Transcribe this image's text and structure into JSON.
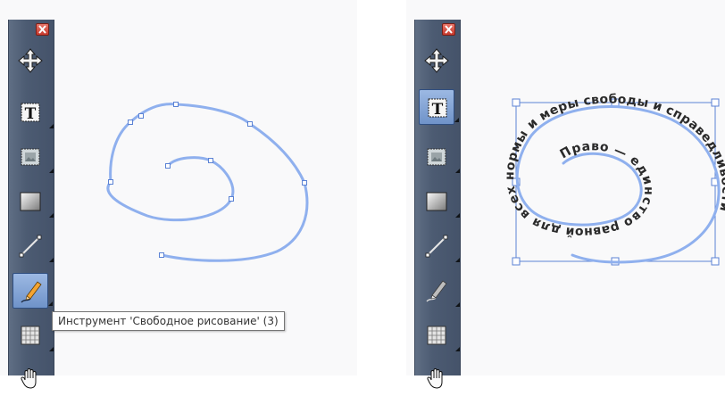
{
  "tooltip": {
    "text": "Инструмент 'Свободное рисование' (3)"
  },
  "tools": [
    {
      "name": "move",
      "icon": "move-arrows-icon"
    },
    {
      "name": "text",
      "icon": "text-tool-icon"
    },
    {
      "name": "frame",
      "icon": "frame-tool-icon"
    },
    {
      "name": "gradient",
      "icon": "gradient-tool-icon"
    },
    {
      "name": "line",
      "icon": "line-tool-icon"
    },
    {
      "name": "freehand",
      "icon": "pencil-icon"
    },
    {
      "name": "grid",
      "icon": "grid-tool-icon"
    },
    {
      "name": "pan",
      "icon": "hand-icon"
    }
  ],
  "left_panel": {
    "active_tool": "freehand"
  },
  "right_panel": {
    "active_tool": "text",
    "path_text": "Право — единство равной для всех нормы и меры свободы и справедливости"
  },
  "colors": {
    "curve": "#8fb0ee",
    "toolbar": "#4f5d74",
    "active_tool": "#7d9fd2",
    "selection_handle": "#5b82d4"
  }
}
